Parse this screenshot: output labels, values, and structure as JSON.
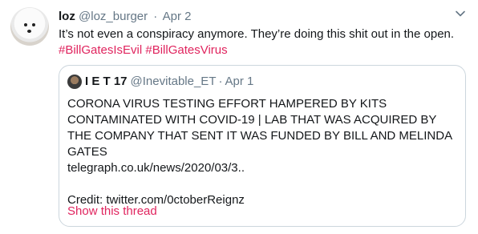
{
  "tweet": {
    "author_name": "loz",
    "author_handle": "@loz_burger",
    "date": "Apr 2",
    "separator": "·",
    "text": "It’s not even a conspiracy anymore. They’re doing this shit out in the open.",
    "hashtags": [
      "#BillGatesIsEvil",
      "#BillGatesVirus"
    ]
  },
  "quote": {
    "author_name": "I E T 17",
    "author_handle": "@Inevitable_ET",
    "date": "Apr 1",
    "separator": "·",
    "lines": [
      "CORONA VIRUS TESTING EFFORT HAMPERED BY KITS CONTAMINATED WITH COVID-19 | LAB THAT WAS ACQUIRED BY THE COMPANY THAT SENT IT WAS FUNDED BY BILL AND MELINDA GATES",
      "telegraph.co.uk/news/2020/03/3..",
      "",
      "Credit: twitter.com/0ctoberReignz"
    ],
    "show_thread": "Show this thread"
  },
  "colors": {
    "accent": "#e0245e",
    "secondary_text": "#657786",
    "border": "#ccd6dd"
  },
  "icons": [
    "chevron-down-icon"
  ]
}
